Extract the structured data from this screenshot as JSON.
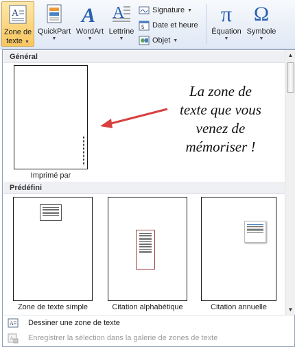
{
  "ribbon": {
    "textbox_button": {
      "line1": "Zone de",
      "line2": "texte"
    },
    "quickpart_button": {
      "label": "QuickPart"
    },
    "wordart_button": {
      "label": "WordArt"
    },
    "lettrine_button": {
      "label": "Lettrine"
    },
    "signature_button": {
      "label": "Signature"
    },
    "datetime_button": {
      "label": "Date et heure"
    },
    "object_button": {
      "label": "Objet"
    },
    "equation_button": {
      "label": "Équation",
      "glyph": "π"
    },
    "symbol_button": {
      "label": "Symbole",
      "glyph": "Ω"
    }
  },
  "gallery": {
    "section_general": "Général",
    "section_predefined": "Prédéfini",
    "general_items": [
      {
        "label": "Imprimé par"
      }
    ],
    "predefined_items": [
      {
        "label": "Zone de texte simple"
      },
      {
        "label": "Citation alphabétique"
      },
      {
        "label": "Citation annuelle"
      }
    ]
  },
  "annotation": {
    "line1": "La zone de",
    "line2": "texte que vous",
    "line3": "venez de",
    "line4": "mémoriser !"
  },
  "menu": {
    "draw_textbox": "Dessiner une zone de texte",
    "save_selection": "Enregistrer la sélection dans la galerie de zones de texte"
  },
  "colors": {
    "active_button": "#f9c65e",
    "arrow": "#d94040",
    "accent_blue": "#1f5aa8"
  }
}
